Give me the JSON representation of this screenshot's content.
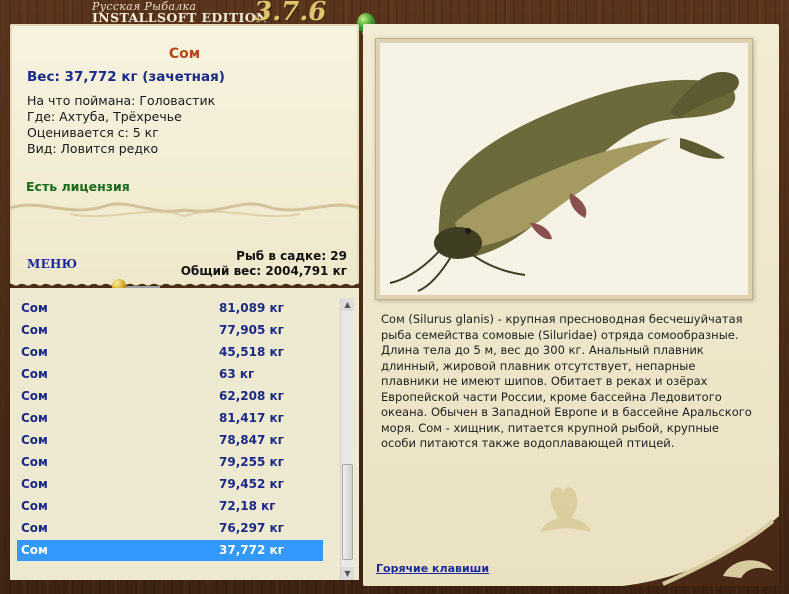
{
  "window": {
    "title_small": "Русская Рыбалка",
    "title_main": "INSTALLSOFT EDITION",
    "version": "3.7.6"
  },
  "fish_info": {
    "name": "Сом",
    "weight_line": "Вес: 37,772 кг (зачетная)",
    "bait_line": "На что поймана: Головастик",
    "location_line": "Где: Ахтуба, Трёхречье",
    "value_line": "Оценивается с: 5 кг",
    "rarity_line": "Вид: Ловится редко",
    "license": "Есть лицензия"
  },
  "menu_label": "МЕНЮ",
  "stats": {
    "fish_in_keepnet": "Рыб в садке: 29",
    "total_weight": "Общий вес: 2004,791 кг"
  },
  "catch_list": [
    {
      "name": "Сом",
      "weight": "81,089 кг"
    },
    {
      "name": "Сом",
      "weight": "77,905 кг"
    },
    {
      "name": "Сом",
      "weight": "45,518 кг"
    },
    {
      "name": "Сом",
      "weight": "63 кг"
    },
    {
      "name": "Сом",
      "weight": "62,208 кг"
    },
    {
      "name": "Сом",
      "weight": "81,417 кг"
    },
    {
      "name": "Сом",
      "weight": "78,847 кг"
    },
    {
      "name": "Сом",
      "weight": "79,255 кг"
    },
    {
      "name": "Сом",
      "weight": "79,452 кг"
    },
    {
      "name": "Сом",
      "weight": "72,18 кг"
    },
    {
      "name": "Сом",
      "weight": "76,297 кг"
    },
    {
      "name": "Сом",
      "weight": "37,772 кг"
    }
  ],
  "description": "Сом (Silurus glanis) - крупная пресноводная бесчешуйчатая рыба семейства сомовые (Siluridae) отряда сомообразные. Длина тела до 5 м, вес до 300 кг. Анальный плавник длинный, жировой плавник отсутствует, непарные плавники не имеют шипов. Обитает в реках и озёрах Европейской части России, кроме бассейна Ледовитого океана. Обычен в Западной Европе и в бассейне Аральского моря. Сом - хищник, питается крупной рыбой, крупные особи питаются также водоплавающей птицей.",
  "hotkeys_label": "Горячие клавиши",
  "colors": {
    "fish_title": "#b5481a",
    "link_blue": "#1a2a9a",
    "license_green": "#1a6a1a",
    "selection": "#3399ff"
  }
}
